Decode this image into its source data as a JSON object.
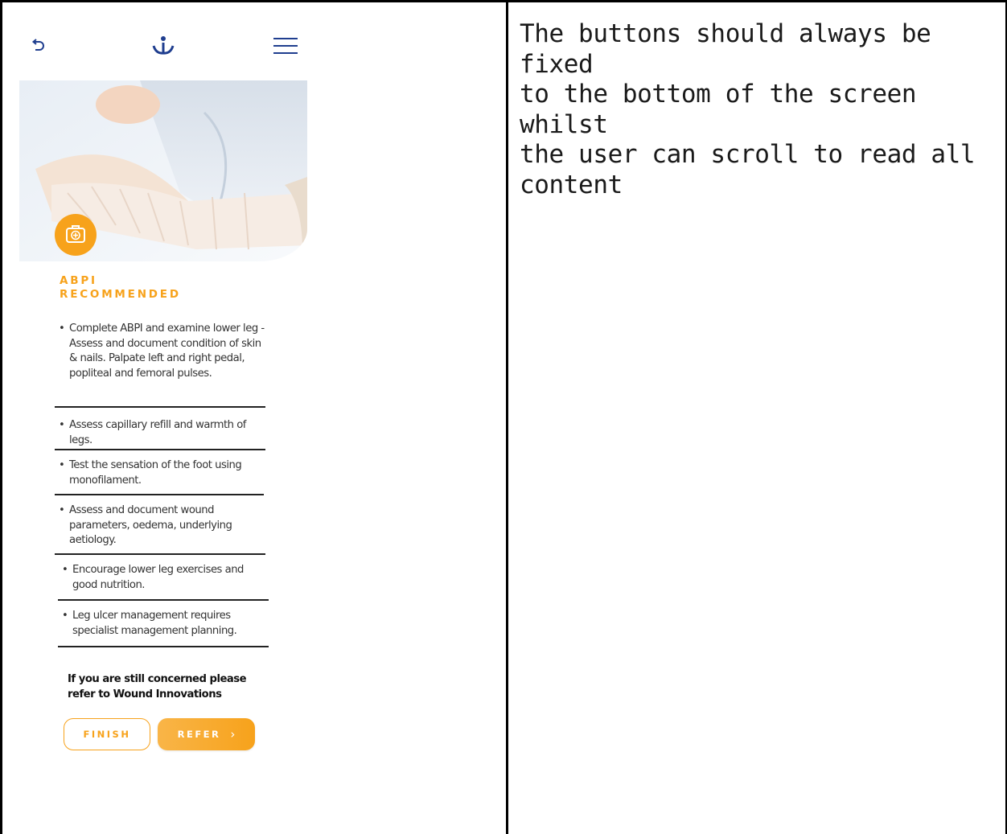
{
  "note": {
    "line1": "The buttons should always be fixed",
    "line2": "to the bottom of the screen whilst",
    "line3": "the user can scroll to read all",
    "line4": "content"
  },
  "header": {
    "back_icon": "back-arrow-icon",
    "logo_icon": "wound-innovations-logo-icon",
    "menu_icon": "hamburger-menu-icon"
  },
  "hero": {
    "image": "bandaged-leg-photo",
    "badge_icon": "medical-kit-icon"
  },
  "section": {
    "title_line1": "ABPI",
    "title_line2": "RECOMMENDED"
  },
  "items": [
    "Complete ABPI and examine lower leg - Assess and document condition of skin & nails. Palpate left and right pedal, popliteal and femoral pulses.",
    "Assess capillary refill and warmth of legs.",
    "Test the sensation of the foot using monofilament.",
    "Assess and document wound parameters, oedema, underlying aetiology.",
    "Encourage lower leg exercises and good nutrition.",
    "Leg ulcer management requires specialist management planning."
  ],
  "bullet": "•",
  "concern": {
    "line1": "If you are still concerned please",
    "line2": "refer to Wound Innovations"
  },
  "buttons": {
    "finish": "FINISH",
    "refer": "REFER",
    "refer_chevron": "›"
  },
  "colors": {
    "accent": "#f7a21b",
    "brand": "#1f3e8f"
  }
}
